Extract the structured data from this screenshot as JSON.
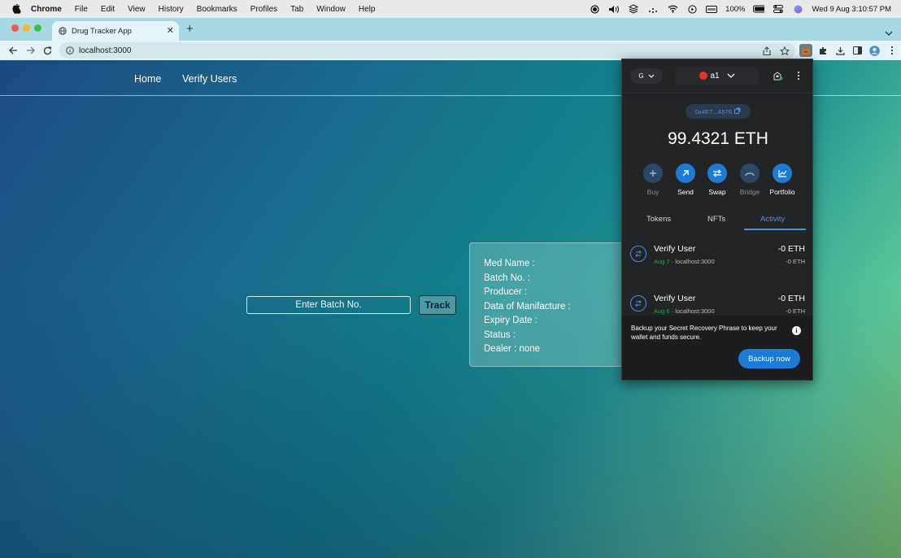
{
  "menubar": {
    "app_name": "Chrome",
    "items": [
      "File",
      "Edit",
      "View",
      "History",
      "Bookmarks",
      "Profiles",
      "Tab",
      "Window",
      "Help"
    ],
    "battery": "100%",
    "datetime": "Wed 9 Aug  3:10:57 PM"
  },
  "browser": {
    "tab_title": "Drug Tracker App",
    "url": "localhost:3000"
  },
  "app": {
    "nav": {
      "home": "Home",
      "verify_users": "Verify Users"
    },
    "search": {
      "placeholder": "Enter Batch No.",
      "value": ""
    },
    "track_label": "Track",
    "info": {
      "med_name": "Med Name :",
      "batch_no": "Batch No. :",
      "producer": "Producer :",
      "manufacture": "Data of Manifacture :",
      "expiry": "Expiry Date :",
      "status": "Status :",
      "dealer": "Dealer : none"
    }
  },
  "metamask": {
    "network_initial": "G",
    "account_label": "a1",
    "address": "0x4E7...A576",
    "balance": "99.4321 ETH",
    "actions": [
      {
        "label": "Buy",
        "icon": "plus-icon",
        "enabled": false
      },
      {
        "label": "Send",
        "icon": "arrow-up-right-icon",
        "enabled": true
      },
      {
        "label": "Swap",
        "icon": "swap-icon",
        "enabled": true
      },
      {
        "label": "Bridge",
        "icon": "bridge-icon",
        "enabled": false
      },
      {
        "label": "Portfolio",
        "icon": "chart-icon",
        "enabled": true
      }
    ],
    "tabs": {
      "tokens": "Tokens",
      "nfts": "NFTs",
      "activity": "Activity",
      "active": "activity"
    },
    "activity": [
      {
        "title": "Verify User",
        "date": "Aug 7",
        "origin": "localhost:3000",
        "amount": "-0 ETH",
        "amount_sub": "-0 ETH"
      },
      {
        "title": "Verify User",
        "date": "Aug 6",
        "origin": "localhost:3000",
        "amount": "-0 ETH",
        "amount_sub": "-0 ETH"
      }
    ],
    "backup": {
      "text": "Backup your Secret Recovery Phrase to keep your wallet and funds secure.",
      "button": "Backup now"
    }
  },
  "colors": {
    "accent": "#1d7bd8",
    "popup_bg": "#232426",
    "tab_strip": "#a8d8e3",
    "account_dot": "#e8351f",
    "date_green": "#2fa34b"
  }
}
